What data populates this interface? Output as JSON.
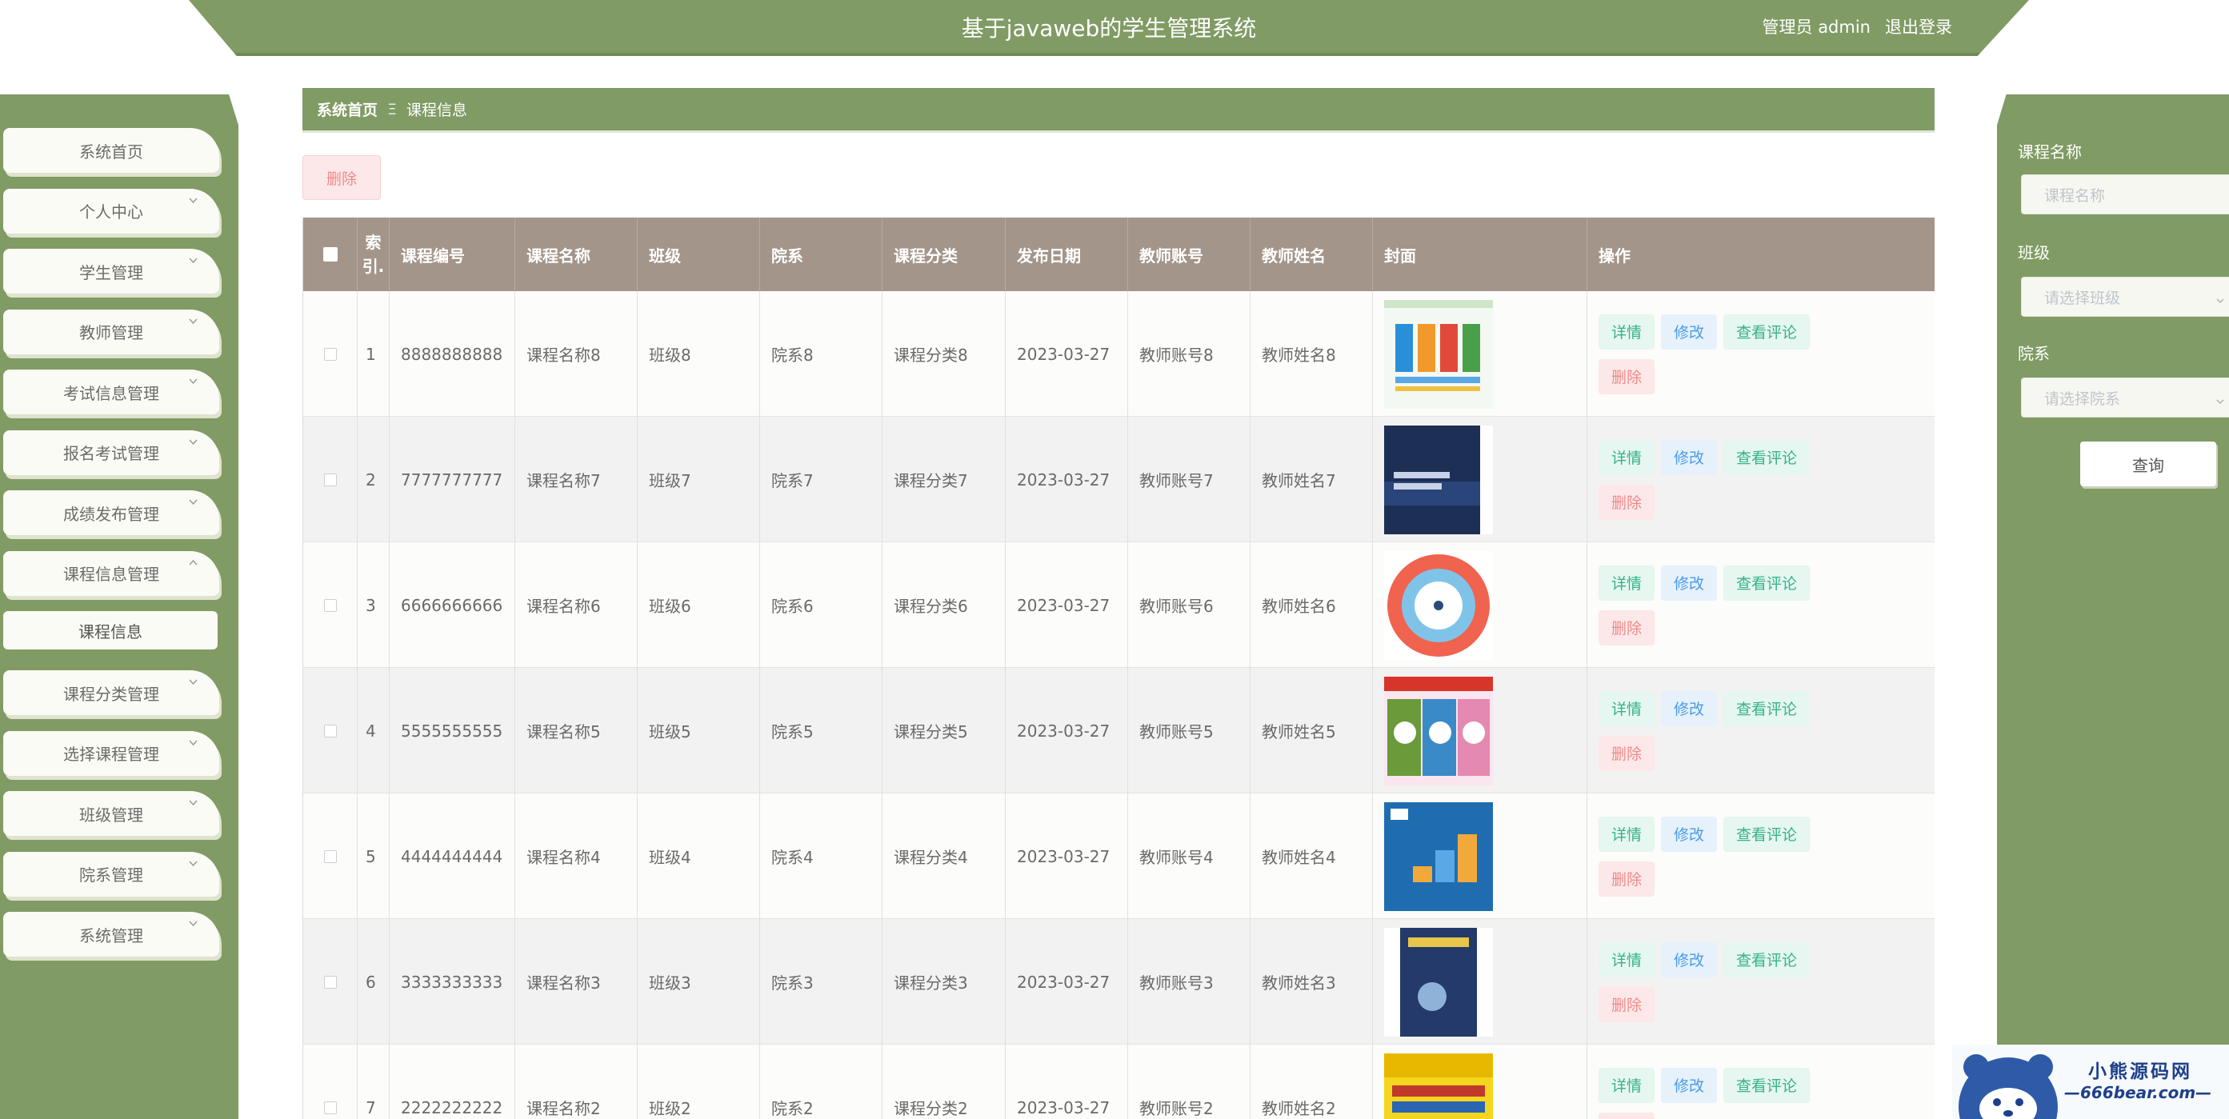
{
  "header": {
    "title": "基于javaweb的学生管理系统",
    "user_label": "管理员 admin",
    "logout": "退出登录"
  },
  "sidebar": {
    "items": [
      {
        "label": "系统首页",
        "expandable": false
      },
      {
        "label": "个人中心",
        "expandable": true
      },
      {
        "label": "学生管理",
        "expandable": true
      },
      {
        "label": "教师管理",
        "expandable": true
      },
      {
        "label": "考试信息管理",
        "expandable": true
      },
      {
        "label": "报名考试管理",
        "expandable": true
      },
      {
        "label": "成绩发布管理",
        "expandable": true
      },
      {
        "label": "课程信息管理",
        "expandable": true,
        "expanded": true
      },
      {
        "label": "课程分类管理",
        "expandable": true
      },
      {
        "label": "选择课程管理",
        "expandable": true
      },
      {
        "label": "班级管理",
        "expandable": true
      },
      {
        "label": "院系管理",
        "expandable": true
      },
      {
        "label": "系统管理",
        "expandable": true
      }
    ],
    "sub_item": "课程信息"
  },
  "breadcrumb": {
    "home": "系统首页",
    "separator": "Ξ",
    "current": "课程信息"
  },
  "toolbar": {
    "delete_label": "删除"
  },
  "table": {
    "headers": [
      "索引",
      "课程编号",
      "课程名称",
      "班级",
      "院系",
      "课程分类",
      "发布日期",
      "教师账号",
      "教师姓名",
      "封面",
      "操作"
    ],
    "index_header_lines": [
      "索",
      "引."
    ],
    "actions": {
      "detail": "详情",
      "edit": "修改",
      "comment": "查看评论",
      "delete": "删除"
    },
    "rows": [
      {
        "index": "1",
        "code": "8888888888",
        "name": "课程名称8",
        "class": "班级8",
        "dept": "院系8",
        "category": "课程分类8",
        "date": "2023-03-27",
        "teacher_account": "教师账号8",
        "teacher_name": "教师姓名8",
        "cover": "cover-chart"
      },
      {
        "index": "2",
        "code": "7777777777",
        "name": "课程名称7",
        "class": "班级7",
        "dept": "院系7",
        "category": "课程分类7",
        "date": "2023-03-27",
        "teacher_account": "教师账号7",
        "teacher_name": "教师姓名7",
        "cover": "cover-darkblue-book"
      },
      {
        "index": "3",
        "code": "6666666666",
        "name": "课程名称6",
        "class": "班级6",
        "dept": "院系6",
        "category": "课程分类6",
        "date": "2023-03-27",
        "teacher_account": "教师账号6",
        "teacher_name": "教师姓名6",
        "cover": "cover-circle"
      },
      {
        "index": "4",
        "code": "5555555555",
        "name": "课程名称5",
        "class": "班级5",
        "dept": "院系5",
        "category": "课程分类5",
        "date": "2023-03-27",
        "teacher_account": "教师账号5",
        "teacher_name": "教师姓名5",
        "cover": "cover-textbooks"
      },
      {
        "index": "5",
        "code": "4444444444",
        "name": "课程名称4",
        "class": "班级4",
        "dept": "院系4",
        "category": "课程分类4",
        "date": "2023-03-27",
        "teacher_account": "教师账号4",
        "teacher_name": "教师姓名4",
        "cover": "cover-ap-blue"
      },
      {
        "index": "6",
        "code": "3333333333",
        "name": "课程名称3",
        "class": "班级3",
        "dept": "院系3",
        "category": "课程分类3",
        "date": "2023-03-27",
        "teacher_account": "教师账号3",
        "teacher_name": "教师姓名3",
        "cover": "cover-explore"
      },
      {
        "index": "7",
        "code": "2222222222",
        "name": "课程名称2",
        "class": "班级2",
        "dept": "院系2",
        "category": "课程分类2",
        "date": "2023-03-27",
        "teacher_account": "教师账号2",
        "teacher_name": "教师姓名2",
        "cover": "cover-english"
      }
    ]
  },
  "search": {
    "course_name_label": "课程名称",
    "course_name_placeholder": "课程名称",
    "class_label": "班级",
    "class_placeholder": "请选择班级",
    "dept_label": "院系",
    "dept_placeholder": "请选择院系",
    "query_button": "查询"
  },
  "watermark": {
    "line1": "小熊源码网",
    "line2": "—666bear.com—"
  },
  "colors": {
    "primary_green": "#809b64",
    "table_header": "#a3958a",
    "detail_green": "#34b38a",
    "edit_blue": "#4a9be8",
    "delete_red": "#f08a8a"
  }
}
